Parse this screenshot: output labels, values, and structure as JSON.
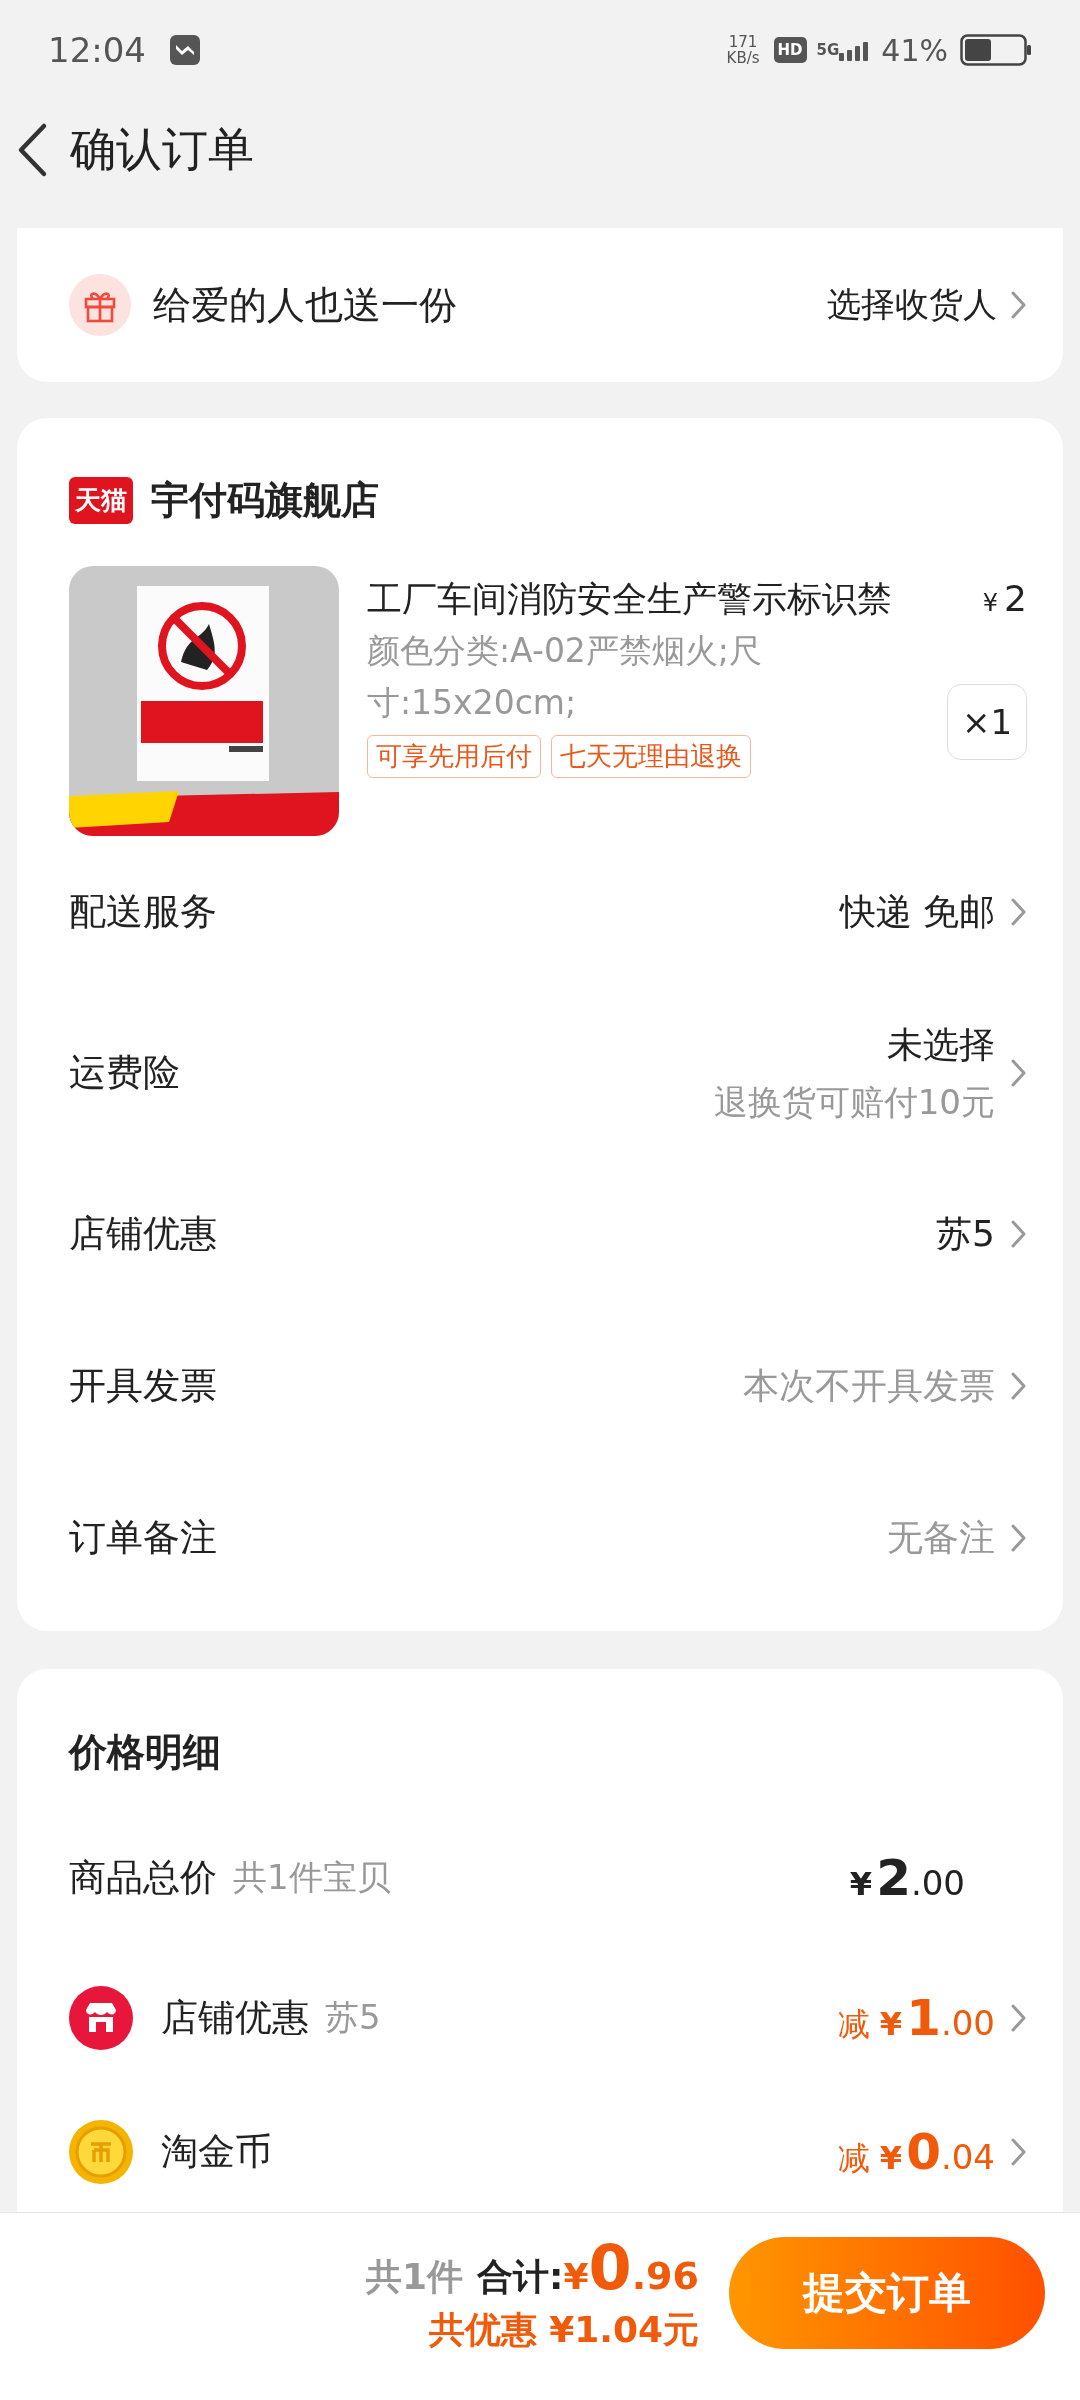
{
  "status_bar": {
    "time": "12:04",
    "net_speed": "171",
    "net_unit": "KB/s",
    "hd": "HD",
    "network": "5G",
    "battery": "41%"
  },
  "header": {
    "title": "确认订单"
  },
  "gift": {
    "label": "给爱的人也送一份",
    "action": "选择收货人"
  },
  "store": {
    "badge": "天猫",
    "name": "宇付码旗舰店",
    "product": {
      "kind": "picture",
      "title": "工厂车间消防安全生产警示标识禁",
      "currency": "¥",
      "price": "2",
      "spec": "颜色分类:A-02严禁烟火;尺寸:15x20cm;",
      "tags": [
        "可享先用后付",
        "七天无理由退换"
      ],
      "quantity": "×1"
    },
    "rows": [
      {
        "label": "配送服务",
        "value": "快递 免邮",
        "muted": false
      },
      {
        "label": "运费险",
        "value": "未选择",
        "note": "退换货可赔付10元",
        "muted": false
      },
      {
        "label": "店铺优惠",
        "value": "苏5",
        "muted": false
      },
      {
        "label": "开具发票",
        "value": "本次不开具发票",
        "muted": true
      },
      {
        "label": "订单备注",
        "value": "无备注",
        "muted": true
      }
    ]
  },
  "price_detail": {
    "title": "价格明细",
    "rows": [
      {
        "kind": "total",
        "label": "商品总价",
        "note": "共1件宝贝",
        "currency": "¥",
        "amount_int": "2",
        "amount_dec": ".00"
      },
      {
        "kind": "store",
        "label": "店铺优惠",
        "note": "苏5",
        "prefix": "减",
        "currency": "¥",
        "amount_int": "1",
        "amount_dec": ".00"
      },
      {
        "kind": "coin",
        "label": "淘金币",
        "prefix": "减",
        "currency": "¥",
        "amount_int": "0",
        "amount_dec": ".04"
      }
    ]
  },
  "footer": {
    "count": "共1件",
    "total_label": "合计:",
    "currency": "¥",
    "amount_int": "0",
    "amount_dec": ".96",
    "savings": "共优惠 ¥1.04元",
    "submit": "提交订单"
  }
}
